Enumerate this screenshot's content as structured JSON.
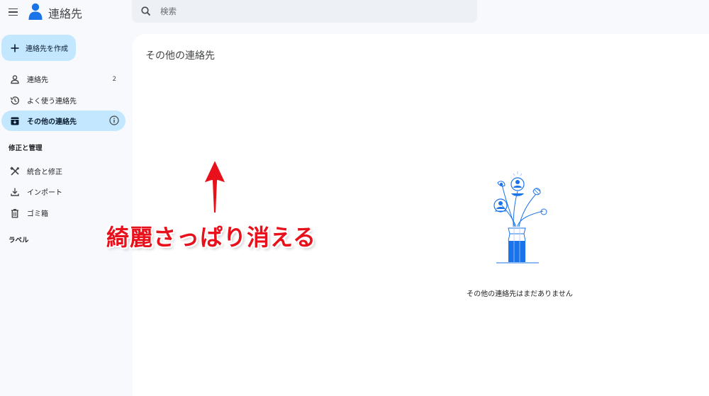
{
  "app": {
    "title": "連絡先"
  },
  "search": {
    "placeholder": "検索",
    "value": ""
  },
  "sidebar": {
    "create_label": "連絡先を作成",
    "items": [
      {
        "label": "連絡先",
        "count": "2",
        "icon": "person-icon",
        "active": false
      },
      {
        "label": "よく使う連絡先",
        "icon": "history-icon",
        "active": false
      },
      {
        "label": "その他の連絡先",
        "icon": "archive-download-icon",
        "active": true
      }
    ],
    "section_manage": "修正と管理",
    "manage_items": [
      {
        "label": "統合と修正",
        "icon": "tools-icon"
      },
      {
        "label": "インポート",
        "icon": "download-icon"
      },
      {
        "label": "ゴミ箱",
        "icon": "trash-icon"
      }
    ],
    "section_labels": "ラベル"
  },
  "main": {
    "page_title": "その他の連絡先",
    "empty_message": "その他の連絡先はまだありません"
  },
  "annotation": {
    "text": "綺麗さっぱり消える",
    "color": "#e8101a"
  },
  "colors": {
    "accent": "#c3e7fe",
    "brand_blue": "#1a73e8",
    "background": "#f7f9fd"
  }
}
